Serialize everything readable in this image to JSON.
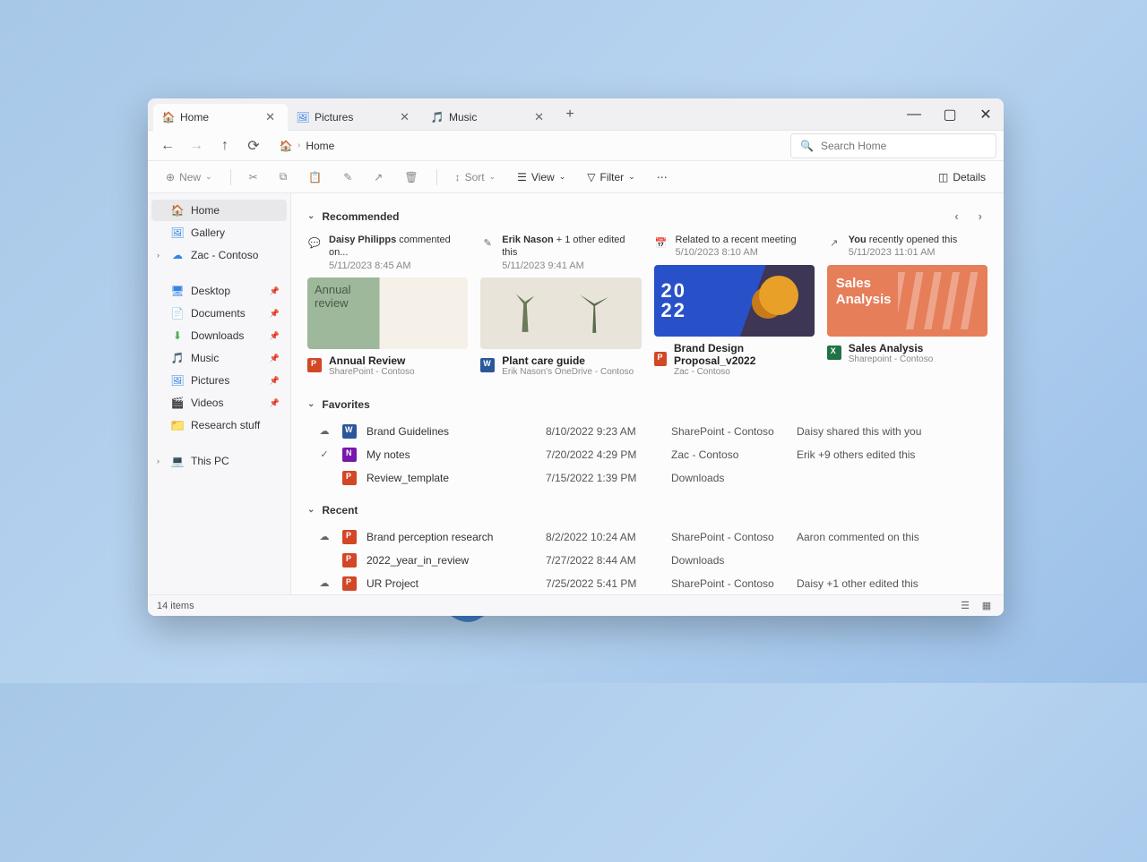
{
  "tabs": [
    {
      "label": "Home",
      "active": true
    },
    {
      "label": "Pictures",
      "active": false
    },
    {
      "label": "Music",
      "active": false
    }
  ],
  "breadcrumb": {
    "current": "Home"
  },
  "search": {
    "placeholder": "Search Home"
  },
  "toolbar": {
    "new": "New",
    "sort": "Sort",
    "view": "View",
    "filter": "Filter",
    "details": "Details"
  },
  "sidebar": {
    "group1": [
      {
        "label": "Home",
        "icon": "home",
        "active": true
      },
      {
        "label": "Gallery",
        "icon": "pic"
      },
      {
        "label": "Zac - Contoso",
        "icon": "cloud",
        "chev": true
      }
    ],
    "group2": [
      {
        "label": "Desktop",
        "icon": "desktop",
        "pin": true
      },
      {
        "label": "Documents",
        "icon": "doc",
        "pin": true
      },
      {
        "label": "Downloads",
        "icon": "down",
        "pin": true
      },
      {
        "label": "Music",
        "icon": "music",
        "pin": true
      },
      {
        "label": "Pictures",
        "icon": "pic",
        "pin": true
      },
      {
        "label": "Videos",
        "icon": "vid",
        "pin": true
      },
      {
        "label": "Research stuff",
        "icon": "rfolder"
      }
    ],
    "group3": [
      {
        "label": "This PC",
        "icon": "pc",
        "chev": true
      }
    ]
  },
  "sections": {
    "recommended": "Recommended",
    "favorites": "Favorites",
    "recent": "Recent"
  },
  "recommended": [
    {
      "meta_bold": "Daisy Philipps",
      "meta_rest": " commented on...",
      "date": "5/11/2023 8:45 AM",
      "title": "Annual Review",
      "sub": "SharePoint - Contoso",
      "thumb": "annual",
      "ficon": "ppt",
      "micon": "💬"
    },
    {
      "meta_bold": "Erik Nason",
      "meta_rest": " + 1 other edited this",
      "date": "5/11/2023 9:41 AM",
      "title": "Plant care guide",
      "sub": "Erik Nason's OneDrive - Contoso",
      "thumb": "plant",
      "ficon": "word",
      "micon": "✎"
    },
    {
      "meta_bold": "",
      "meta_rest": "Related to a recent meeting",
      "date": "5/10/2023 8:10 AM",
      "title": "Brand Design Proposal_v2022",
      "sub": "Zac - Contoso",
      "thumb": "brand",
      "ficon": "ppt",
      "micon": "📅"
    },
    {
      "meta_bold": "You",
      "meta_rest": " recently opened this",
      "date": "5/11/2023 11:01 AM",
      "title": "Sales Analysis",
      "sub": "Sharepoint - Contoso",
      "thumb": "sales",
      "ficon": "xl",
      "micon": "↗"
    }
  ],
  "favorites": [
    {
      "status": "☁",
      "icon": "word",
      "name": "Brand Guidelines",
      "date": "8/10/2022 9:23 AM",
      "loc": "SharePoint - Contoso",
      "info": "Daisy shared this with you"
    },
    {
      "status": "✓",
      "icon": "one",
      "name": "My notes",
      "date": "7/20/2022 4:29 PM",
      "loc": "Zac - Contoso",
      "info": "Erik +9 others edited this"
    },
    {
      "status": "",
      "icon": "ppt",
      "name": "Review_template",
      "date": "7/15/2022 1:39 PM",
      "loc": "Downloads",
      "info": ""
    }
  ],
  "recent": [
    {
      "status": "☁",
      "icon": "ppt",
      "name": "Brand perception research",
      "date": "8/2/2022 10:24 AM",
      "loc": "SharePoint - Contoso",
      "info": "Aaron commented on this"
    },
    {
      "status": "",
      "icon": "ppt",
      "name": "2022_year_in_review",
      "date": "7/27/2022 8:44 AM",
      "loc": "Downloads",
      "info": ""
    },
    {
      "status": "☁",
      "icon": "ppt",
      "name": "UR Project",
      "date": "7/25/2022 5:41 PM",
      "loc": "SharePoint - Contoso",
      "info": "Daisy +1 other edited this"
    }
  ],
  "statusbar": {
    "items": "14 items"
  }
}
